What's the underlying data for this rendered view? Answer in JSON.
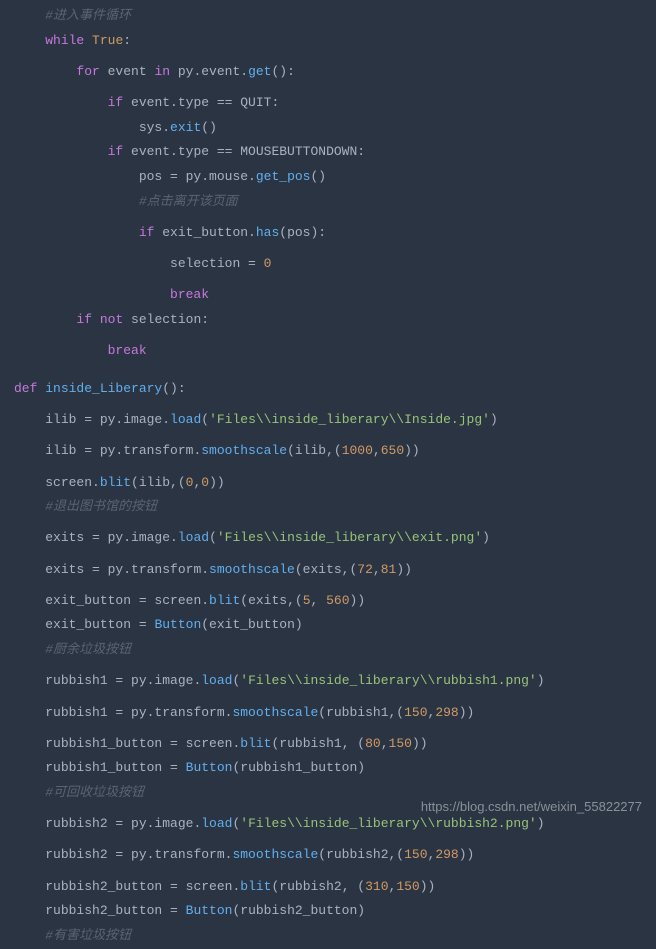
{
  "watermark": "https://blog.csdn.net/weixin_55822277",
  "code_lines": [
    {
      "indent": 1,
      "type": "comment",
      "text": "#进入事件循环"
    },
    {
      "indent": 1,
      "tokens": [
        {
          "t": "kw",
          "v": "while"
        },
        {
          "t": "sp",
          "v": " "
        },
        {
          "t": "bool",
          "v": "True"
        },
        {
          "t": "p",
          "v": ":"
        }
      ]
    },
    {
      "indent": 0,
      "tokens": []
    },
    {
      "indent": 2,
      "tokens": [
        {
          "t": "kw",
          "v": "for"
        },
        {
          "t": "sp",
          "v": " event "
        },
        {
          "t": "kw",
          "v": "in"
        },
        {
          "t": "sp",
          "v": " py.event."
        },
        {
          "t": "fn",
          "v": "get"
        },
        {
          "t": "p",
          "v": "():"
        }
      ]
    },
    {
      "indent": 0,
      "tokens": []
    },
    {
      "indent": 3,
      "tokens": [
        {
          "t": "kw",
          "v": "if"
        },
        {
          "t": "sp",
          "v": " event.type == QUIT:"
        }
      ]
    },
    {
      "indent": 4,
      "tokens": [
        {
          "t": "sp",
          "v": "sys."
        },
        {
          "t": "fn",
          "v": "exit"
        },
        {
          "t": "p",
          "v": "()"
        }
      ]
    },
    {
      "indent": 3,
      "tokens": [
        {
          "t": "kw",
          "v": "if"
        },
        {
          "t": "sp",
          "v": " event.type == MOUSEBUTTONDOWN:"
        }
      ]
    },
    {
      "indent": 4,
      "tokens": [
        {
          "t": "sp",
          "v": "pos = py.mouse."
        },
        {
          "t": "fn",
          "v": "get_pos"
        },
        {
          "t": "p",
          "v": "()"
        }
      ]
    },
    {
      "indent": 4,
      "type": "comment",
      "text": "#点击离开该页面"
    },
    {
      "indent": 0,
      "tokens": []
    },
    {
      "indent": 4,
      "tokens": [
        {
          "t": "kw",
          "v": "if"
        },
        {
          "t": "sp",
          "v": " exit_button."
        },
        {
          "t": "fn",
          "v": "has"
        },
        {
          "t": "p",
          "v": "(pos):"
        }
      ]
    },
    {
      "indent": 0,
      "tokens": []
    },
    {
      "indent": 5,
      "tokens": [
        {
          "t": "sp",
          "v": "selection = "
        },
        {
          "t": "num",
          "v": "0"
        }
      ]
    },
    {
      "indent": 0,
      "tokens": []
    },
    {
      "indent": 5,
      "tokens": [
        {
          "t": "kw",
          "v": "break"
        }
      ]
    },
    {
      "indent": 2,
      "tokens": [
        {
          "t": "kw",
          "v": "if"
        },
        {
          "t": "sp",
          "v": " "
        },
        {
          "t": "kw",
          "v": "not"
        },
        {
          "t": "sp",
          "v": " selection:"
        }
      ]
    },
    {
      "indent": 0,
      "tokens": []
    },
    {
      "indent": 3,
      "tokens": [
        {
          "t": "kw",
          "v": "break"
        }
      ]
    },
    {
      "indent": 0,
      "tokens": []
    },
    {
      "indent": 0,
      "tokens": []
    },
    {
      "indent": 0,
      "tokens": [
        {
          "t": "kw",
          "v": "def"
        },
        {
          "t": "sp",
          "v": " "
        },
        {
          "t": "fn",
          "v": "inside_Liberary"
        },
        {
          "t": "p",
          "v": "():"
        }
      ]
    },
    {
      "indent": 0,
      "tokens": []
    },
    {
      "indent": 1,
      "tokens": [
        {
          "t": "sp",
          "v": "ilib = py.image."
        },
        {
          "t": "fn",
          "v": "load"
        },
        {
          "t": "p",
          "v": "("
        },
        {
          "t": "str",
          "v": "'Files\\\\inside_liberary\\\\Inside.jpg'"
        },
        {
          "t": "p",
          "v": ")"
        }
      ]
    },
    {
      "indent": 0,
      "tokens": []
    },
    {
      "indent": 1,
      "tokens": [
        {
          "t": "sp",
          "v": "ilib = py.transform."
        },
        {
          "t": "fn",
          "v": "smoothscale"
        },
        {
          "t": "p",
          "v": "(ilib,("
        },
        {
          "t": "num",
          "v": "1000"
        },
        {
          "t": "p",
          "v": ","
        },
        {
          "t": "num",
          "v": "650"
        },
        {
          "t": "p",
          "v": "))"
        }
      ]
    },
    {
      "indent": 0,
      "tokens": []
    },
    {
      "indent": 1,
      "tokens": [
        {
          "t": "sp",
          "v": "screen."
        },
        {
          "t": "fn",
          "v": "blit"
        },
        {
          "t": "p",
          "v": "(ilib,("
        },
        {
          "t": "num",
          "v": "0"
        },
        {
          "t": "p",
          "v": ","
        },
        {
          "t": "num",
          "v": "0"
        },
        {
          "t": "p",
          "v": "))"
        }
      ]
    },
    {
      "indent": 1,
      "type": "comment",
      "text": "#退出图书馆的按钮"
    },
    {
      "indent": 0,
      "tokens": []
    },
    {
      "indent": 1,
      "tokens": [
        {
          "t": "sp",
          "v": "exits = py.image."
        },
        {
          "t": "fn",
          "v": "load"
        },
        {
          "t": "p",
          "v": "("
        },
        {
          "t": "str",
          "v": "'Files\\\\inside_liberary\\\\exit.png'"
        },
        {
          "t": "p",
          "v": ")"
        }
      ]
    },
    {
      "indent": 0,
      "tokens": []
    },
    {
      "indent": 1,
      "tokens": [
        {
          "t": "sp",
          "v": "exits = py.transform."
        },
        {
          "t": "fn",
          "v": "smoothscale"
        },
        {
          "t": "p",
          "v": "(exits,("
        },
        {
          "t": "num",
          "v": "72"
        },
        {
          "t": "p",
          "v": ","
        },
        {
          "t": "num",
          "v": "81"
        },
        {
          "t": "p",
          "v": "))"
        }
      ]
    },
    {
      "indent": 0,
      "tokens": []
    },
    {
      "indent": 1,
      "tokens": [
        {
          "t": "sp",
          "v": "exit_button = screen."
        },
        {
          "t": "fn",
          "v": "blit"
        },
        {
          "t": "p",
          "v": "(exits,("
        },
        {
          "t": "num",
          "v": "5"
        },
        {
          "t": "p",
          "v": ", "
        },
        {
          "t": "num",
          "v": "560"
        },
        {
          "t": "p",
          "v": "))"
        }
      ]
    },
    {
      "indent": 1,
      "tokens": [
        {
          "t": "sp",
          "v": "exit_button = "
        },
        {
          "t": "fn",
          "v": "Button"
        },
        {
          "t": "p",
          "v": "(exit_button)"
        }
      ]
    },
    {
      "indent": 1,
      "type": "comment",
      "text": "#厨余垃圾按钮"
    },
    {
      "indent": 0,
      "tokens": []
    },
    {
      "indent": 1,
      "tokens": [
        {
          "t": "sp",
          "v": "rubbish1 = py.image."
        },
        {
          "t": "fn",
          "v": "load"
        },
        {
          "t": "p",
          "v": "("
        },
        {
          "t": "str",
          "v": "'Files\\\\inside_liberary\\\\rubbish1.png'"
        },
        {
          "t": "p",
          "v": ")"
        }
      ]
    },
    {
      "indent": 0,
      "tokens": []
    },
    {
      "indent": 1,
      "tokens": [
        {
          "t": "sp",
          "v": "rubbish1 = py.transform."
        },
        {
          "t": "fn",
          "v": "smoothscale"
        },
        {
          "t": "p",
          "v": "(rubbish1,("
        },
        {
          "t": "num",
          "v": "150"
        },
        {
          "t": "p",
          "v": ","
        },
        {
          "t": "num",
          "v": "298"
        },
        {
          "t": "p",
          "v": "))"
        }
      ]
    },
    {
      "indent": 0,
      "tokens": []
    },
    {
      "indent": 1,
      "tokens": [
        {
          "t": "sp",
          "v": "rubbish1_button = screen."
        },
        {
          "t": "fn",
          "v": "blit"
        },
        {
          "t": "p",
          "v": "(rubbish1, ("
        },
        {
          "t": "num",
          "v": "80"
        },
        {
          "t": "p",
          "v": ","
        },
        {
          "t": "num",
          "v": "150"
        },
        {
          "t": "p",
          "v": "))"
        }
      ]
    },
    {
      "indent": 1,
      "tokens": [
        {
          "t": "sp",
          "v": "rubbish1_button = "
        },
        {
          "t": "fn",
          "v": "Button"
        },
        {
          "t": "p",
          "v": "(rubbish1_button)"
        }
      ]
    },
    {
      "indent": 1,
      "type": "comment",
      "text": "#可回收垃圾按钮"
    },
    {
      "indent": 0,
      "tokens": []
    },
    {
      "indent": 1,
      "tokens": [
        {
          "t": "sp",
          "v": "rubbish2 = py.image."
        },
        {
          "t": "fn",
          "v": "load"
        },
        {
          "t": "p",
          "v": "("
        },
        {
          "t": "str",
          "v": "'Files\\\\inside_liberary\\\\rubbish2.png'"
        },
        {
          "t": "p",
          "v": ")"
        }
      ]
    },
    {
      "indent": 0,
      "tokens": []
    },
    {
      "indent": 1,
      "tokens": [
        {
          "t": "sp",
          "v": "rubbish2 = py.transform."
        },
        {
          "t": "fn",
          "v": "smoothscale"
        },
        {
          "t": "p",
          "v": "(rubbish2,("
        },
        {
          "t": "num",
          "v": "150"
        },
        {
          "t": "p",
          "v": ","
        },
        {
          "t": "num",
          "v": "298"
        },
        {
          "t": "p",
          "v": "))"
        }
      ]
    },
    {
      "indent": 0,
      "tokens": []
    },
    {
      "indent": 1,
      "tokens": [
        {
          "t": "sp",
          "v": "rubbish2_button = screen."
        },
        {
          "t": "fn",
          "v": "blit"
        },
        {
          "t": "p",
          "v": "(rubbish2, ("
        },
        {
          "t": "num",
          "v": "310"
        },
        {
          "t": "p",
          "v": ","
        },
        {
          "t": "num",
          "v": "150"
        },
        {
          "t": "p",
          "v": "))"
        }
      ]
    },
    {
      "indent": 1,
      "tokens": [
        {
          "t": "sp",
          "v": "rubbish2_button = "
        },
        {
          "t": "fn",
          "v": "Button"
        },
        {
          "t": "p",
          "v": "(rubbish2_button)"
        }
      ]
    },
    {
      "indent": 1,
      "type": "comment",
      "text": "#有害垃圾按钮"
    }
  ]
}
